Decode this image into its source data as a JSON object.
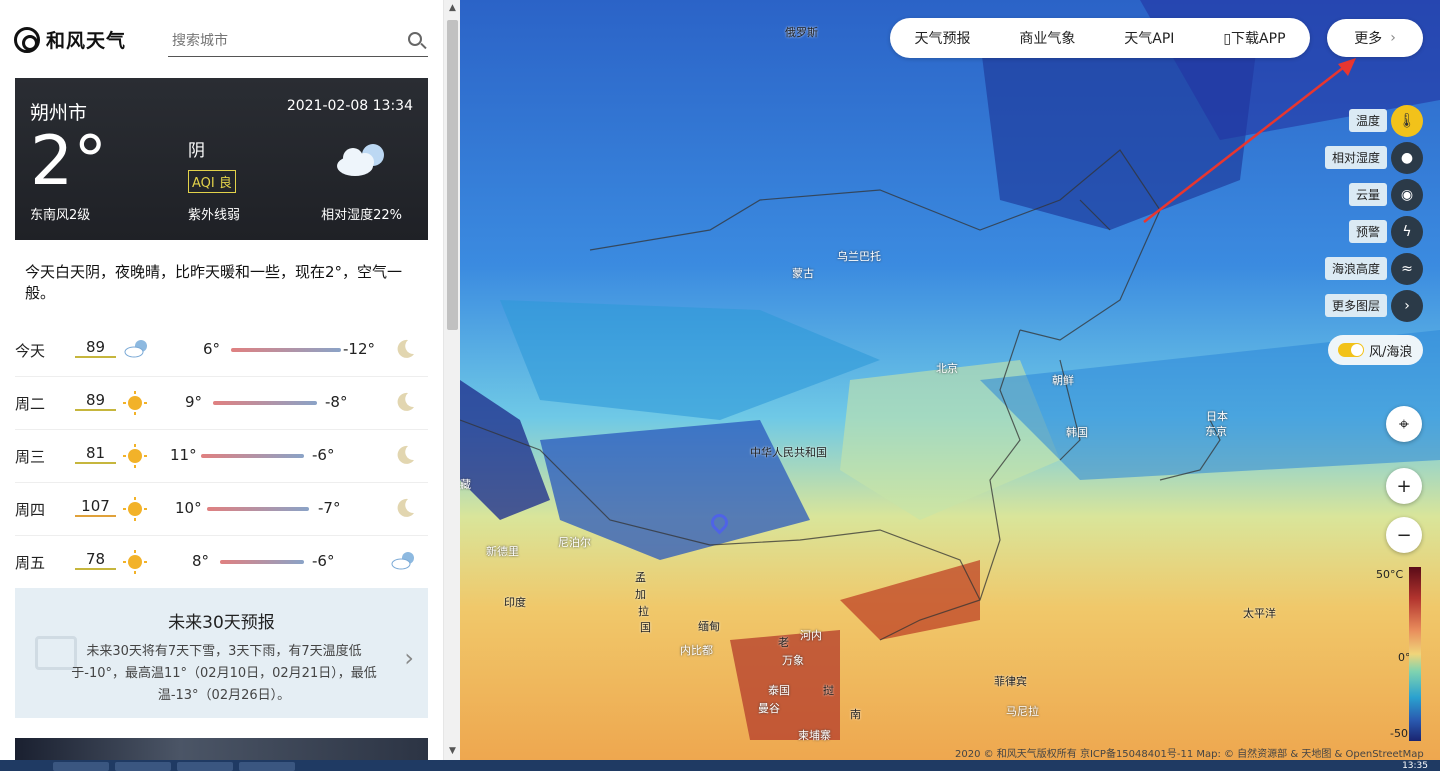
{
  "brand": {
    "name": "和风天气"
  },
  "search": {
    "placeholder": "搜索城市"
  },
  "current": {
    "city": "朔州市",
    "datetime": "2021-02-08 13:34",
    "temp": "2°",
    "condition": "阴",
    "aqi": "AQI 良",
    "wind": "东南风2级",
    "uv": "紫外线弱",
    "humidity": "相对湿度22%"
  },
  "summary": "今天白天阴，夜晚晴，比昨天暖和一些，现在2°，空气一般。",
  "days": [
    {
      "name": "今天",
      "aqi": "89",
      "hi": "6°",
      "lo": "-12°",
      "day_icon": "cloudy-icon",
      "night_icon": "moon-icon"
    },
    {
      "name": "周二",
      "aqi": "89",
      "hi": "9°",
      "lo": "-8°",
      "day_icon": "sun-icon",
      "night_icon": "moon-icon"
    },
    {
      "name": "周三",
      "aqi": "81",
      "hi": "11°",
      "lo": "-6°",
      "day_icon": "sun-icon",
      "night_icon": "moon-icon"
    },
    {
      "name": "周四",
      "aqi": "107",
      "hi": "10°",
      "lo": "-7°",
      "day_icon": "sun-icon",
      "night_icon": "moon-icon"
    },
    {
      "name": "周五",
      "aqi": "78",
      "hi": "8°",
      "lo": "-6°",
      "day_icon": "sun-icon",
      "night_icon": "cloudy-icon"
    }
  ],
  "forecast30": {
    "title": "未来30天预报",
    "desc": "未来30天将有7天下雪，3天下雨，有7天温度低于-10°，最高温11°（02月10日，02月21日），最低温-13°（02月26日）。"
  },
  "nav": {
    "items": [
      "天气预报",
      "商业气象",
      "天气API",
      "下载APP"
    ],
    "more": "更多"
  },
  "layers": [
    "温度",
    "相对湿度",
    "云量",
    "预警",
    "海浪高度",
    "更多图层"
  ],
  "wind_toggle": "风/海浪",
  "legend": {
    "max": "50°C",
    "mid": "0°C",
    "min": "-50°C"
  },
  "map_labels": {
    "russia": "俄罗斯",
    "ulaanbaatar": "乌兰巴托",
    "mongolia": "蒙古",
    "beijing": "北京",
    "nkorea": "朝鲜",
    "skorea": "韩国",
    "japan": "日本",
    "tokyo": "东京",
    "china": "中华人民共和国",
    "nepal": "尼泊尔",
    "delhi": "新德里",
    "india": "印度",
    "bangladesh_1": "孟",
    "bangladesh_2": "加",
    "bangladesh_3": "拉",
    "bangladesh_4": "国",
    "myanmar": "缅甸",
    "naypyidaw": "内比都",
    "laos": "老",
    "hanoi": "河内",
    "vientiane": "万象",
    "thailand": "泰国",
    "bangkok": "曼谷",
    "vietnam": "越",
    "cambodia": "柬埔寨",
    "nam": "南",
    "philippines": "菲律宾",
    "manila": "马尼拉",
    "pacific": "太平洋",
    "tibet": "藏",
    "laos2": "挝"
  },
  "copyright": "2020 © 和风天气版权所有 京ICP备15048401号-11 Map: © 自然资源部 & 天地图 & OpenStreetMap",
  "taskbar_time": "13:35"
}
